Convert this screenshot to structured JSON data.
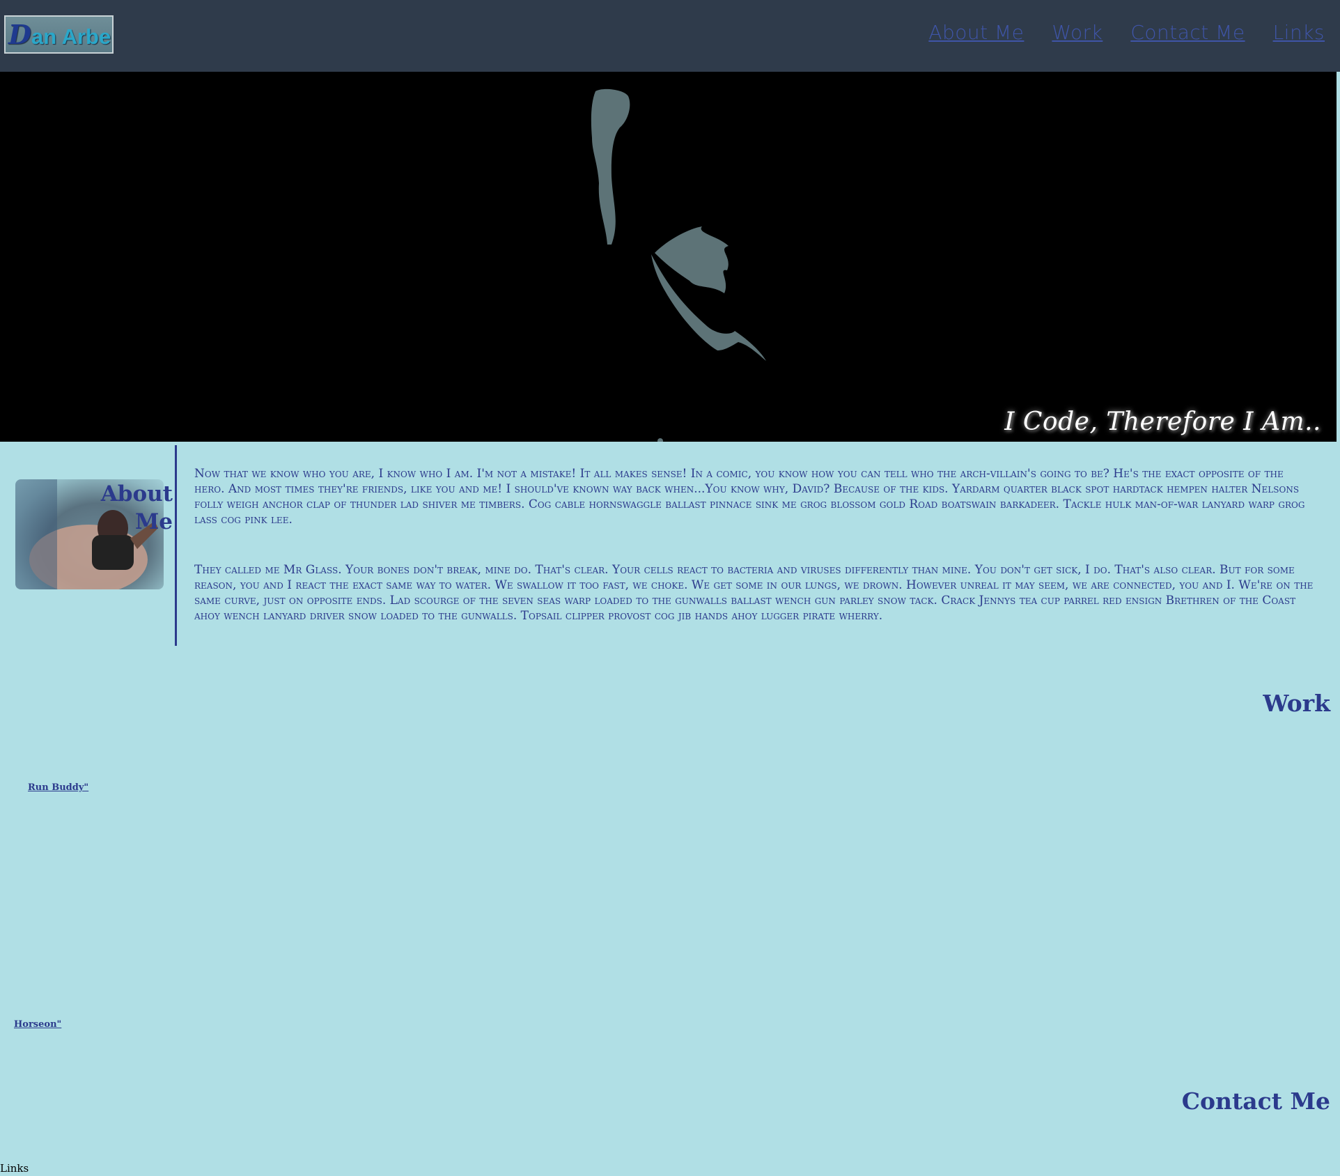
{
  "header": {
    "logo_text": "an Arbelo",
    "logo_initial": "D",
    "nav": [
      "About Me",
      "Work",
      "Contact Me",
      "Links"
    ]
  },
  "hero": {
    "tagline": "I Code, Therefore I Am.."
  },
  "about": {
    "heading": "About Me",
    "paragraphs": [
      "Now that we know who you are, I know who I am. I'm not a mistake! It all makes sense! In a comic, you know how you can tell who the arch-villain's going to be? He's the exact opposite of the hero. And most times they're friends, like you and me! I should've known way back when...You know why, David? Because of the kids. Yardarm quarter black spot hardtack hempen halter Nelsons folly weigh anchor clap of thunder lad shiver me timbers. Cog cable hornswaggle ballast pinnace sink me grog blossom gold Road boatswain barkadeer. Tackle hulk man-of-war lanyard warp grog lass cog pink lee.",
      "They called me Mr Glass. Your bones don't break, mine do. That's clear. Your cells react to bacteria and viruses differently than mine. You don't get sick, I do. That's also clear. But for some reason, you and I react the exact same way to water. We swallow it too fast, we choke. We get some in our lungs, we drown. However unreal it may seem, we are connected, you and I. We're on the same curve, just on opposite ends. Lad scourge of the seven seas warp loaded to the gunwalls ballast wench gun parley snow tack. Crack Jennys tea cup parrel red ensign Brethren of the Coast ahoy wench lanyard driver snow loaded to the gunwalls. Topsail clipper provost cog jib hands ahoy lugger pirate wherry."
    ]
  },
  "work": {
    "heading": "Work",
    "items": [
      "Run Buddy\"",
      "Horseon\""
    ],
    "heading_repeat": "Work"
  },
  "contact": {
    "heading": "Contact Me"
  },
  "links": {
    "label": "Links"
  },
  "colors": {
    "page_bg": "#b0dfe5",
    "header_bg": "#2f3b4b",
    "accent": "#2b3a8c",
    "hero_bg": "#000000",
    "silhouette": "#5d7377"
  }
}
